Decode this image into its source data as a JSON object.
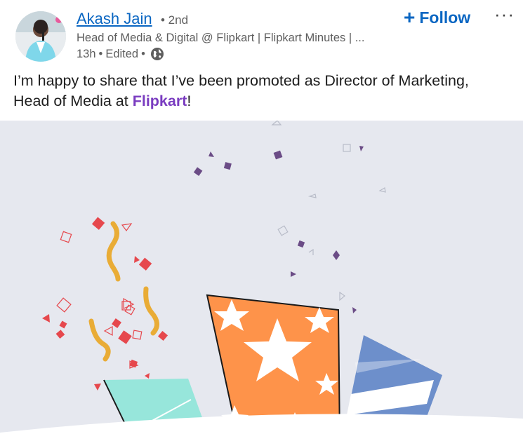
{
  "author": {
    "name": "Akash Jain",
    "degree": "• 2nd",
    "headline": "Head of Media & Digital @ Flipkart | Flipkart Minutes | ...",
    "time": "13h",
    "separator": "•",
    "edited": "Edited",
    "visibility_icon": "globe-icon"
  },
  "actions": {
    "follow_label": "Follow",
    "follow_icon": "plus-icon",
    "more_label": "···",
    "more_icon": "ellipsis-icon"
  },
  "post": {
    "text_before": "I’m happy to share that I’ve been promoted as Director of Marketing, Head of Media at ",
    "mention": "Flipkart",
    "text_after": "!"
  },
  "colors": {
    "link": "#0a66c2",
    "mention": "#7a3cc0",
    "media_background": "#e6e8ef",
    "orange_box": "#fe934a",
    "blue_box": "#6d8fcb",
    "teal_box": "#97e6db",
    "confetti_red": "#e6484d",
    "confetti_purple": "#6b4c86",
    "streamer_yellow": "#e9ac36"
  }
}
